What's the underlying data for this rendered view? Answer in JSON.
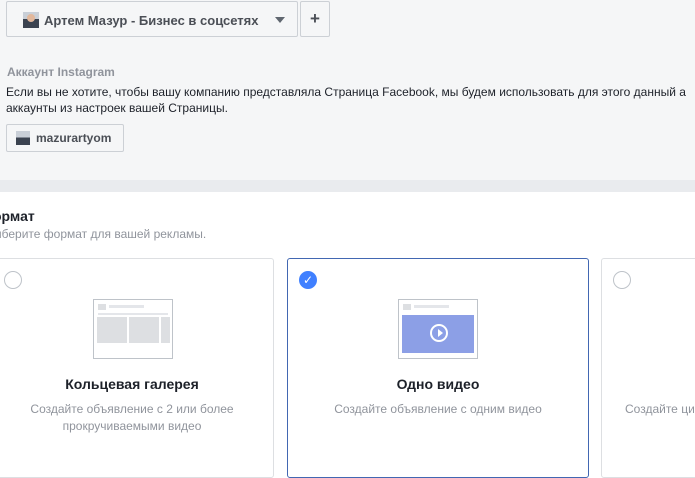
{
  "page_selector": {
    "name": "Артем Мазур - Бизнес в соцсетях",
    "icon": "avatar",
    "caret_icon": "chevron-down-icon"
  },
  "add_button": {
    "label": "+"
  },
  "instagram": {
    "title": "Аккаунт Instagram",
    "description": "Если вы не хотите, чтобы вашу компанию представляла Страница Facebook, мы будем использовать для этого данный а аккаунты из настроек вашей Страницы.",
    "account": "mazurartyom"
  },
  "format": {
    "title": "ормат",
    "subtitle": "ыберите формат для вашей рекламы.",
    "cards": [
      {
        "title": "Кольцевая галерея",
        "description": "Создайте объявление с 2 или более прокручиваемыми видео",
        "selected": false
      },
      {
        "title": "Одно видео",
        "description": "Создайте объявление с одним видео",
        "selected": true
      },
      {
        "title": "",
        "description": "Создайте ци",
        "selected": false
      }
    ]
  },
  "colors": {
    "accent": "#4080ff",
    "selected_border": "#4267b2",
    "divider": "#e9ebee"
  }
}
